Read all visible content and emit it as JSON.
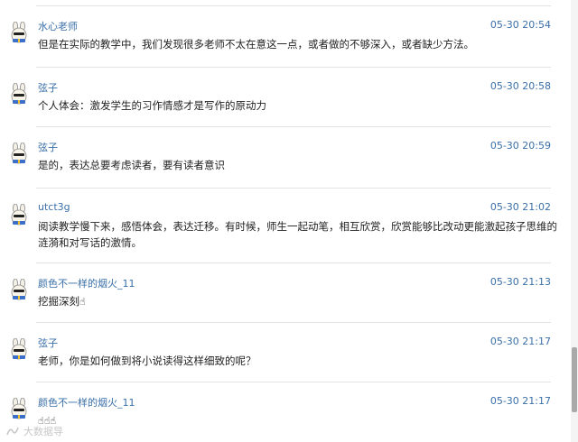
{
  "messages": [
    {
      "name": "水心老师",
      "time": "05-30 20:54",
      "text": "但是在实际的教学中，我们发现很多老师不太在意这一点，或者做的不够深入，或者缺少方法。"
    },
    {
      "name": "弦子",
      "time": "05-30 20:58",
      "text": "个人体会：激发学生的习作情感才是写作的原动力"
    },
    {
      "name": "弦子",
      "time": "05-30 20:59",
      "text": "是的，表达总要考虑读者，要有读者意识"
    },
    {
      "name": "utct3g",
      "time": "05-30 21:02",
      "text": "阅读教学慢下来，感悟体会，表达迁移。有时候，师生一起动笔，相互欣赏，欣赏能够比改动更能激起孩子思维的涟漪和对写话的激情。"
    },
    {
      "name": "颜色不一样的烟火_11",
      "time": "05-30 21:13",
      "text": "挖掘深刻",
      "emoji": "☝"
    },
    {
      "name": "弦子",
      "time": "05-30 21:17",
      "text": "老师，你是如何做到将小说读得这样细致的呢？"
    },
    {
      "name": "颜色不一样的烟火_11",
      "time": "05-30 21:17",
      "text": "",
      "emoji": "☝☝☝"
    }
  ],
  "watermark": "大数据导"
}
